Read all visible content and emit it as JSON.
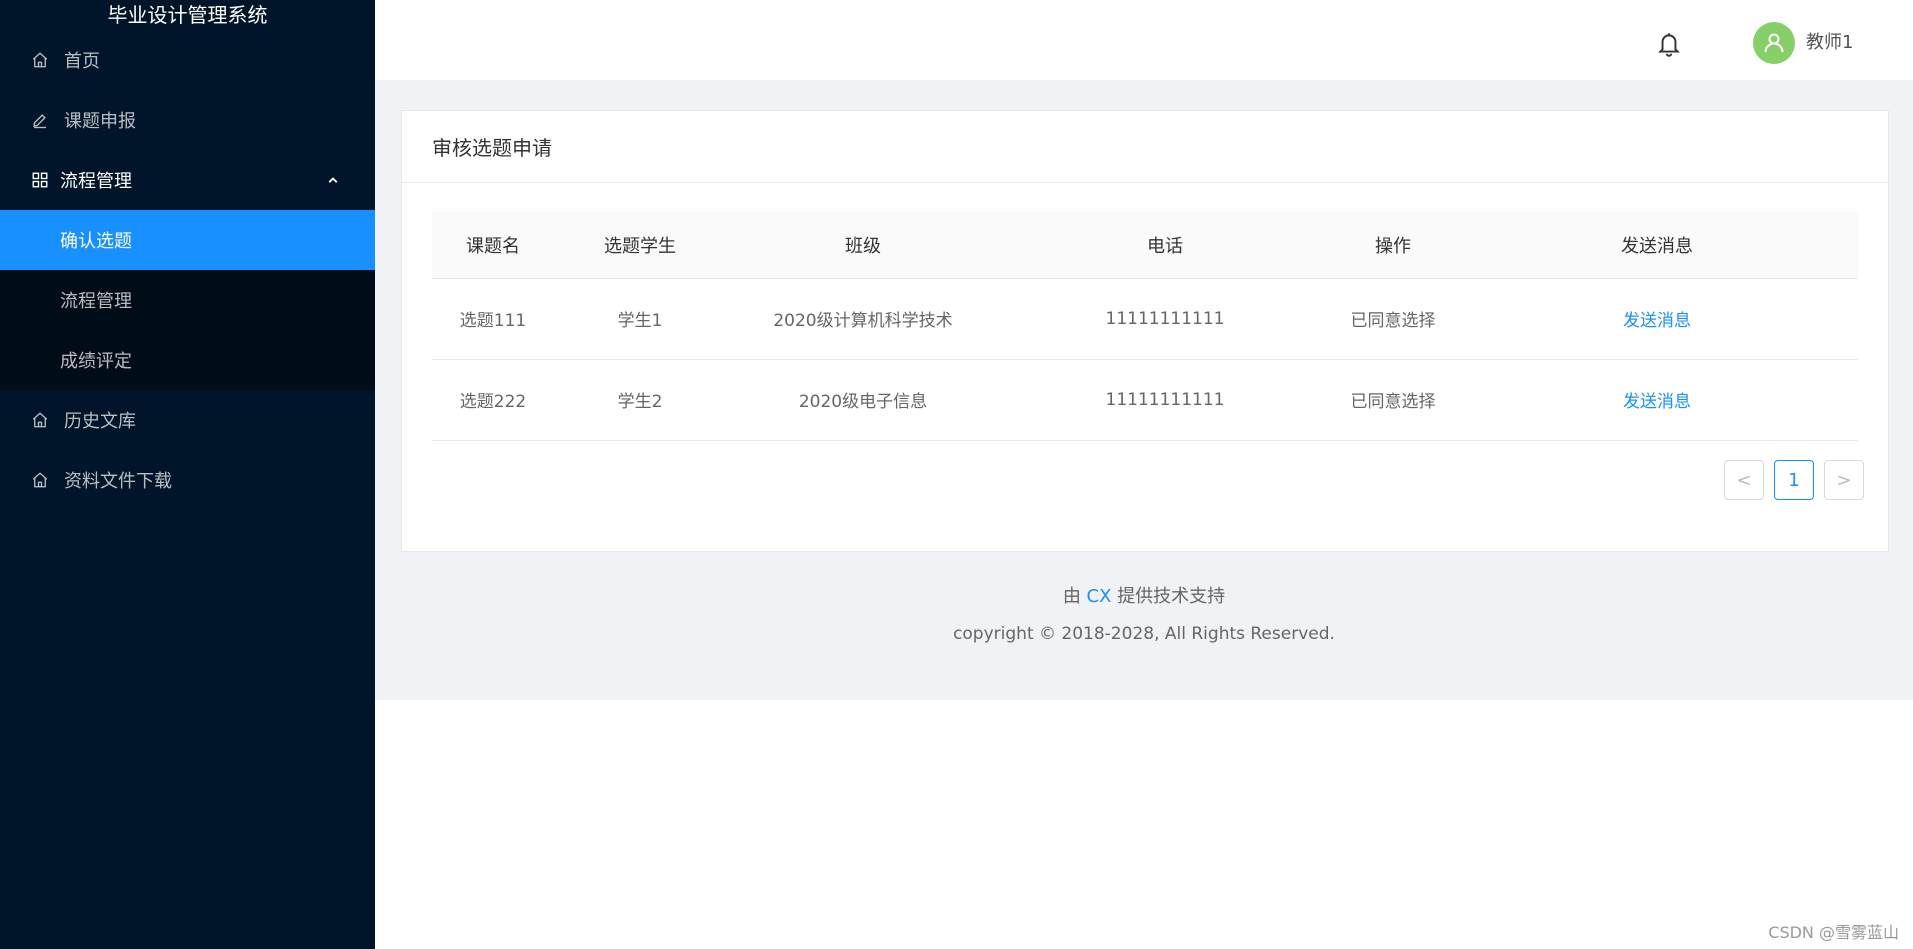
{
  "sidebar": {
    "title": "毕业设计管理系统",
    "items": [
      {
        "label": "首页",
        "icon": "home-icon"
      },
      {
        "label": "课题申报",
        "icon": "edit-icon"
      },
      {
        "label": "流程管理",
        "icon": "appstore-icon",
        "expanded": true,
        "children": [
          {
            "label": "确认选题",
            "active": true
          },
          {
            "label": "流程管理"
          },
          {
            "label": "成绩评定"
          }
        ]
      },
      {
        "label": "历史文库",
        "icon": "home-icon"
      },
      {
        "label": "资料文件下载",
        "icon": "home-icon"
      }
    ]
  },
  "header": {
    "bell_icon": "bell-icon",
    "avatar_icon": "user-icon",
    "avatar_color": "#87d068",
    "username": "教师1"
  },
  "card": {
    "title": "审核选题申请",
    "table": {
      "columns": [
        "课题名",
        "选题学生",
        "班级",
        "电话",
        "操作",
        "发送消息"
      ],
      "rows": [
        [
          "选题111",
          "学生1",
          "2020级计算机科学技术",
          "11111111111",
          "已同意选择",
          "发送消息"
        ],
        [
          "选题222",
          "学生2",
          "2020级电子信息",
          "11111111111",
          "已同意选择",
          "发送消息"
        ]
      ]
    },
    "pagination": {
      "current": "1",
      "prev": "<",
      "next": ">"
    }
  },
  "footer": {
    "prefix": "由",
    "link": "CX",
    "suffix": "提供技术支持",
    "copyright": "copyright © 2018-2028, All Rights Reserved."
  },
  "watermark": "CSDN @雪雾蓝山",
  "colors": {
    "sidebar_bg": "#001529",
    "submenu_bg": "#000c17",
    "accent": "#1890ff",
    "content_bg": "#f0f2f5"
  }
}
